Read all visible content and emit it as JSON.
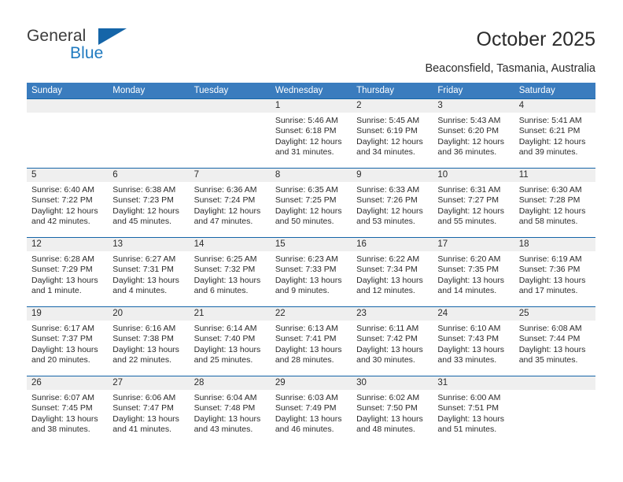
{
  "brand": {
    "line1": "General",
    "line2": "Blue",
    "mark": "triangle-logo-icon",
    "accent_color": "#1565a8"
  },
  "header": {
    "title": "October 2025",
    "subtitle": "Beaconsfield, Tasmania, Australia"
  },
  "calendar": {
    "header_color": "#3a7cbe",
    "daynum_band_color": "#efefef",
    "separator_color": "#1565a8",
    "weekdays": [
      "Sunday",
      "Monday",
      "Tuesday",
      "Wednesday",
      "Thursday",
      "Friday",
      "Saturday"
    ],
    "weeks": [
      [
        {
          "day": "",
          "sunrise": "",
          "sunset": "",
          "daylight_line1": "",
          "daylight_line2": ""
        },
        {
          "day": "",
          "sunrise": "",
          "sunset": "",
          "daylight_line1": "",
          "daylight_line2": ""
        },
        {
          "day": "",
          "sunrise": "",
          "sunset": "",
          "daylight_line1": "",
          "daylight_line2": ""
        },
        {
          "day": "1",
          "sunrise": "Sunrise: 5:46 AM",
          "sunset": "Sunset: 6:18 PM",
          "daylight_line1": "Daylight: 12 hours",
          "daylight_line2": "and 31 minutes."
        },
        {
          "day": "2",
          "sunrise": "Sunrise: 5:45 AM",
          "sunset": "Sunset: 6:19 PM",
          "daylight_line1": "Daylight: 12 hours",
          "daylight_line2": "and 34 minutes."
        },
        {
          "day": "3",
          "sunrise": "Sunrise: 5:43 AM",
          "sunset": "Sunset: 6:20 PM",
          "daylight_line1": "Daylight: 12 hours",
          "daylight_line2": "and 36 minutes."
        },
        {
          "day": "4",
          "sunrise": "Sunrise: 5:41 AM",
          "sunset": "Sunset: 6:21 PM",
          "daylight_line1": "Daylight: 12 hours",
          "daylight_line2": "and 39 minutes."
        }
      ],
      [
        {
          "day": "5",
          "sunrise": "Sunrise: 6:40 AM",
          "sunset": "Sunset: 7:22 PM",
          "daylight_line1": "Daylight: 12 hours",
          "daylight_line2": "and 42 minutes."
        },
        {
          "day": "6",
          "sunrise": "Sunrise: 6:38 AM",
          "sunset": "Sunset: 7:23 PM",
          "daylight_line1": "Daylight: 12 hours",
          "daylight_line2": "and 45 minutes."
        },
        {
          "day": "7",
          "sunrise": "Sunrise: 6:36 AM",
          "sunset": "Sunset: 7:24 PM",
          "daylight_line1": "Daylight: 12 hours",
          "daylight_line2": "and 47 minutes."
        },
        {
          "day": "8",
          "sunrise": "Sunrise: 6:35 AM",
          "sunset": "Sunset: 7:25 PM",
          "daylight_line1": "Daylight: 12 hours",
          "daylight_line2": "and 50 minutes."
        },
        {
          "day": "9",
          "sunrise": "Sunrise: 6:33 AM",
          "sunset": "Sunset: 7:26 PM",
          "daylight_line1": "Daylight: 12 hours",
          "daylight_line2": "and 53 minutes."
        },
        {
          "day": "10",
          "sunrise": "Sunrise: 6:31 AM",
          "sunset": "Sunset: 7:27 PM",
          "daylight_line1": "Daylight: 12 hours",
          "daylight_line2": "and 55 minutes."
        },
        {
          "day": "11",
          "sunrise": "Sunrise: 6:30 AM",
          "sunset": "Sunset: 7:28 PM",
          "daylight_line1": "Daylight: 12 hours",
          "daylight_line2": "and 58 minutes."
        }
      ],
      [
        {
          "day": "12",
          "sunrise": "Sunrise: 6:28 AM",
          "sunset": "Sunset: 7:29 PM",
          "daylight_line1": "Daylight: 13 hours",
          "daylight_line2": "and 1 minute."
        },
        {
          "day": "13",
          "sunrise": "Sunrise: 6:27 AM",
          "sunset": "Sunset: 7:31 PM",
          "daylight_line1": "Daylight: 13 hours",
          "daylight_line2": "and 4 minutes."
        },
        {
          "day": "14",
          "sunrise": "Sunrise: 6:25 AM",
          "sunset": "Sunset: 7:32 PM",
          "daylight_line1": "Daylight: 13 hours",
          "daylight_line2": "and 6 minutes."
        },
        {
          "day": "15",
          "sunrise": "Sunrise: 6:23 AM",
          "sunset": "Sunset: 7:33 PM",
          "daylight_line1": "Daylight: 13 hours",
          "daylight_line2": "and 9 minutes."
        },
        {
          "day": "16",
          "sunrise": "Sunrise: 6:22 AM",
          "sunset": "Sunset: 7:34 PM",
          "daylight_line1": "Daylight: 13 hours",
          "daylight_line2": "and 12 minutes."
        },
        {
          "day": "17",
          "sunrise": "Sunrise: 6:20 AM",
          "sunset": "Sunset: 7:35 PM",
          "daylight_line1": "Daylight: 13 hours",
          "daylight_line2": "and 14 minutes."
        },
        {
          "day": "18",
          "sunrise": "Sunrise: 6:19 AM",
          "sunset": "Sunset: 7:36 PM",
          "daylight_line1": "Daylight: 13 hours",
          "daylight_line2": "and 17 minutes."
        }
      ],
      [
        {
          "day": "19",
          "sunrise": "Sunrise: 6:17 AM",
          "sunset": "Sunset: 7:37 PM",
          "daylight_line1": "Daylight: 13 hours",
          "daylight_line2": "and 20 minutes."
        },
        {
          "day": "20",
          "sunrise": "Sunrise: 6:16 AM",
          "sunset": "Sunset: 7:38 PM",
          "daylight_line1": "Daylight: 13 hours",
          "daylight_line2": "and 22 minutes."
        },
        {
          "day": "21",
          "sunrise": "Sunrise: 6:14 AM",
          "sunset": "Sunset: 7:40 PM",
          "daylight_line1": "Daylight: 13 hours",
          "daylight_line2": "and 25 minutes."
        },
        {
          "day": "22",
          "sunrise": "Sunrise: 6:13 AM",
          "sunset": "Sunset: 7:41 PM",
          "daylight_line1": "Daylight: 13 hours",
          "daylight_line2": "and 28 minutes."
        },
        {
          "day": "23",
          "sunrise": "Sunrise: 6:11 AM",
          "sunset": "Sunset: 7:42 PM",
          "daylight_line1": "Daylight: 13 hours",
          "daylight_line2": "and 30 minutes."
        },
        {
          "day": "24",
          "sunrise": "Sunrise: 6:10 AM",
          "sunset": "Sunset: 7:43 PM",
          "daylight_line1": "Daylight: 13 hours",
          "daylight_line2": "and 33 minutes."
        },
        {
          "day": "25",
          "sunrise": "Sunrise: 6:08 AM",
          "sunset": "Sunset: 7:44 PM",
          "daylight_line1": "Daylight: 13 hours",
          "daylight_line2": "and 35 minutes."
        }
      ],
      [
        {
          "day": "26",
          "sunrise": "Sunrise: 6:07 AM",
          "sunset": "Sunset: 7:45 PM",
          "daylight_line1": "Daylight: 13 hours",
          "daylight_line2": "and 38 minutes."
        },
        {
          "day": "27",
          "sunrise": "Sunrise: 6:06 AM",
          "sunset": "Sunset: 7:47 PM",
          "daylight_line1": "Daylight: 13 hours",
          "daylight_line2": "and 41 minutes."
        },
        {
          "day": "28",
          "sunrise": "Sunrise: 6:04 AM",
          "sunset": "Sunset: 7:48 PM",
          "daylight_line1": "Daylight: 13 hours",
          "daylight_line2": "and 43 minutes."
        },
        {
          "day": "29",
          "sunrise": "Sunrise: 6:03 AM",
          "sunset": "Sunset: 7:49 PM",
          "daylight_line1": "Daylight: 13 hours",
          "daylight_line2": "and 46 minutes."
        },
        {
          "day": "30",
          "sunrise": "Sunrise: 6:02 AM",
          "sunset": "Sunset: 7:50 PM",
          "daylight_line1": "Daylight: 13 hours",
          "daylight_line2": "and 48 minutes."
        },
        {
          "day": "31",
          "sunrise": "Sunrise: 6:00 AM",
          "sunset": "Sunset: 7:51 PM",
          "daylight_line1": "Daylight: 13 hours",
          "daylight_line2": "and 51 minutes."
        },
        {
          "day": "",
          "sunrise": "",
          "sunset": "",
          "daylight_line1": "",
          "daylight_line2": ""
        }
      ]
    ]
  }
}
